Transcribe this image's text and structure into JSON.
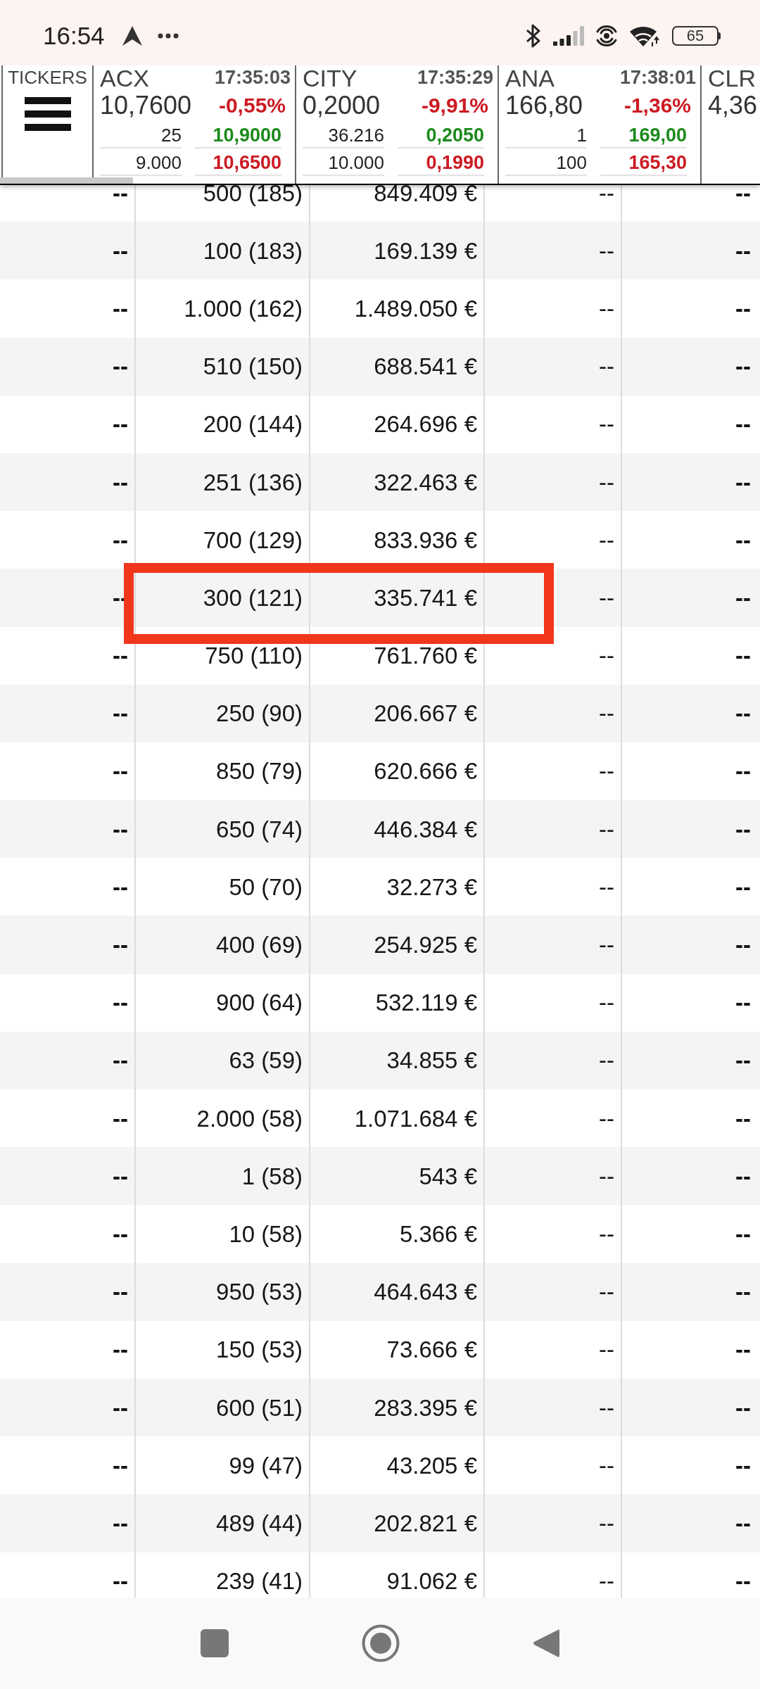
{
  "status_bar": {
    "time": "16:54",
    "battery": "65"
  },
  "tickers_panel": {
    "label": "TICKERS"
  },
  "tickers": [
    {
      "symbol": "ACX",
      "time": "17:35:03",
      "price": "10,7600",
      "change": "-0,55%",
      "quotes": [
        {
          "quantity": "25",
          "price": "10,9000",
          "color": "#1b8a1b"
        },
        {
          "quantity": "9.000",
          "price": "10,6500",
          "color": "#cc1a22"
        }
      ]
    },
    {
      "symbol": "CITY",
      "time": "17:35:29",
      "price": "0,2000",
      "change": "-9,91%",
      "quotes": [
        {
          "quantity": "36.216",
          "price": "0,2050",
          "color": "#1b8a1b"
        },
        {
          "quantity": "10.000",
          "price": "0,1990",
          "color": "#cc1a22"
        }
      ]
    },
    {
      "symbol": "ANA",
      "time": "17:38:01",
      "price": "166,80",
      "change": "-1,36%",
      "quotes": [
        {
          "quantity": "1",
          "price": "169,00",
          "color": "#1b8a1b"
        },
        {
          "quantity": "100",
          "price": "165,30",
          "color": "#cc1a22"
        }
      ]
    },
    {
      "symbol": "CLR",
      "price": "4,36"
    }
  ],
  "table": {
    "rows": [
      {
        "cells": [
          "--",
          "500 (185)",
          "849.409 €",
          "--",
          "--"
        ],
        "highlighted": false
      },
      {
        "cells": [
          "--",
          "100 (183)",
          "169.139 €",
          "--",
          "--"
        ],
        "highlighted": false
      },
      {
        "cells": [
          "--",
          "1.000 (162)",
          "1.489.050 €",
          "--",
          "--"
        ],
        "highlighted": false
      },
      {
        "cells": [
          "--",
          "510 (150)",
          "688.541 €",
          "--",
          "--"
        ],
        "highlighted": false
      },
      {
        "cells": [
          "--",
          "200 (144)",
          "264.696 €",
          "--",
          "--"
        ],
        "highlighted": false
      },
      {
        "cells": [
          "--",
          "251 (136)",
          "322.463 €",
          "--",
          "--"
        ],
        "highlighted": false
      },
      {
        "cells": [
          "--",
          "700 (129)",
          "833.936 €",
          "--",
          "--"
        ],
        "highlighted": false
      },
      {
        "cells": [
          "--",
          "300 (121)",
          "335.741 €",
          "--",
          "--"
        ],
        "highlighted": true
      },
      {
        "cells": [
          "--",
          "750 (110)",
          "761.760 €",
          "--",
          "--"
        ],
        "highlighted": false
      },
      {
        "cells": [
          "--",
          "250 (90)",
          "206.667 €",
          "--",
          "--"
        ],
        "highlighted": false
      },
      {
        "cells": [
          "--",
          "850 (79)",
          "620.666 €",
          "--",
          "--"
        ],
        "highlighted": false
      },
      {
        "cells": [
          "--",
          "650 (74)",
          "446.384 €",
          "--",
          "--"
        ],
        "highlighted": false
      },
      {
        "cells": [
          "--",
          "50 (70)",
          "32.273 €",
          "--",
          "--"
        ],
        "highlighted": false
      },
      {
        "cells": [
          "--",
          "400 (69)",
          "254.925 €",
          "--",
          "--"
        ],
        "highlighted": false
      },
      {
        "cells": [
          "--",
          "900 (64)",
          "532.119 €",
          "--",
          "--"
        ],
        "highlighted": false
      },
      {
        "cells": [
          "--",
          "63 (59)",
          "34.855 €",
          "--",
          "--"
        ],
        "highlighted": false
      },
      {
        "cells": [
          "--",
          "2.000 (58)",
          "1.071.684 €",
          "--",
          "--"
        ],
        "highlighted": false
      },
      {
        "cells": [
          "--",
          "1 (58)",
          "543 €",
          "--",
          "--"
        ],
        "highlighted": false
      },
      {
        "cells": [
          "--",
          "10 (58)",
          "5.366 €",
          "--",
          "--"
        ],
        "highlighted": false
      },
      {
        "cells": [
          "--",
          "950 (53)",
          "464.643 €",
          "--",
          "--"
        ],
        "highlighted": false
      },
      {
        "cells": [
          "--",
          "150 (53)",
          "73.666 €",
          "--",
          "--"
        ],
        "highlighted": false
      },
      {
        "cells": [
          "--",
          "600 (51)",
          "283.395 €",
          "--",
          "--"
        ],
        "highlighted": false
      },
      {
        "cells": [
          "--",
          "99 (47)",
          "43.205 €",
          "--",
          "--"
        ],
        "highlighted": false
      },
      {
        "cells": [
          "--",
          "489 (44)",
          "202.821 €",
          "--",
          "--"
        ],
        "highlighted": false
      },
      {
        "cells": [
          "--",
          "239 (41)",
          "91.062 €",
          "--",
          "--"
        ],
        "highlighted": false
      }
    ]
  }
}
